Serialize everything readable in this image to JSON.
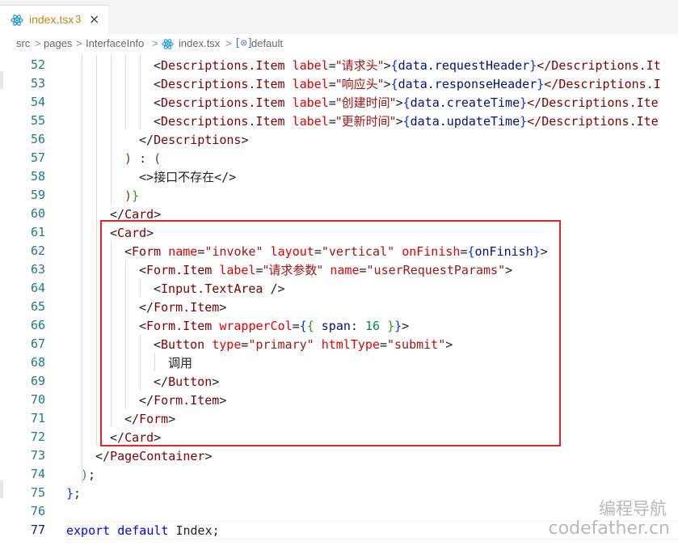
{
  "tab": {
    "filename": "index.tsx",
    "problem_count": "3",
    "close_glyph": "×",
    "icon": "react-icon"
  },
  "breadcrumb": {
    "items": [
      "src",
      "pages",
      "InterfaceInfo",
      "index.tsx",
      "default"
    ],
    "separator": ">",
    "symbol_glyph": "[⊙]"
  },
  "editor": {
    "line_numbers": [
      "52",
      "53",
      "54",
      "55",
      "56",
      "57",
      "58",
      "59",
      "60",
      "61",
      "62",
      "63",
      "64",
      "65",
      "66",
      "67",
      "68",
      "69",
      "70",
      "71",
      "72",
      "73",
      "74",
      "75",
      "76",
      "77"
    ],
    "current_line": "77",
    "text": {
      "desc_item": "Descriptions.Item",
      "descriptions": "Descriptions",
      "label_attr": "label",
      "label_reqheader": "\"请求头\"",
      "label_respheader": "\"响应头\"",
      "label_create": "\"创建时间\"",
      "label_update": "\"更新时间\"",
      "data_reqheader": "data.requestHeader",
      "data_respheader": "data.responseHeader",
      "data_create": "data.createTime",
      "data_update": "data.updateTime",
      "tail_it": "</Descriptions.It",
      "tail_i": "</Descriptions.I",
      "tail_ite": "</Descriptions.Ite",
      "not_exist": "接口不存在",
      "card": "Card",
      "form": "Form",
      "name_attr": "name",
      "name_invoke": "\"invoke\"",
      "layout_attr": "layout",
      "layout_val": "\"vertical\"",
      "onfinish_attr": "onFinish",
      "onfinish_var": "onFinish",
      "form_item": "Form.Item",
      "label_params": "\"请求参数\"",
      "name_params": "\"userRequestParams\"",
      "textarea": "Input.TextArea",
      "wrapper_attr": "wrapperCol",
      "span_key": "span",
      "span_val": "16",
      "button": "Button",
      "type_attr": "type",
      "type_val": "\"primary\"",
      "htmltype_attr": "htmlType",
      "htmltype_val": "\"submit\"",
      "invoke_label": "调用",
      "pagecontainer": "PageContainer",
      "kw_export": "export",
      "kw_default": "default",
      "ident_index": "Index"
    }
  },
  "watermark": {
    "line1": "编程导航",
    "line2": "codefather.cn"
  },
  "colors": {
    "tab_text": "#c4841a",
    "line_number": "#237893",
    "highlight_box": "#e02828",
    "tag": "#800000",
    "attribute": "#e50000",
    "string": "#a31515",
    "keyword": "#0000ff"
  }
}
